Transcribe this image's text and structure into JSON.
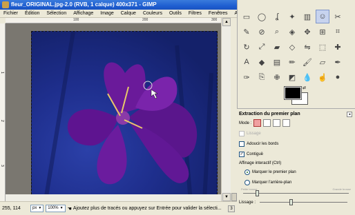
{
  "window": {
    "title": "fleur_ORIGINAL.jpg-2.0 (RVB, 1 calque) 400x371 - GIMP"
  },
  "menu": [
    "Fichier",
    "Édition",
    "Sélection",
    "Affichage",
    "Image",
    "Calque",
    "Couleurs",
    "Outils",
    "Filtres",
    "Fenêtres",
    "Aide"
  ],
  "ruler_top": [
    "100",
    "200",
    "300"
  ],
  "ruler_left": [
    "1",
    "2",
    "3"
  ],
  "status": {
    "coords": "255, 114",
    "unit": "px",
    "zoom": "100%",
    "message": "Ajoutez plus de tracés ou appuyez sur Entrée pour valider la sélecti...",
    "cancel": "3"
  },
  "tools": [
    {
      "name": "rect-select-icon",
      "glyph": "▭"
    },
    {
      "name": "ellipse-select-icon",
      "glyph": "◯"
    },
    {
      "name": "free-select-icon",
      "glyph": "ʆ"
    },
    {
      "name": "fuzzy-select-icon",
      "glyph": "✦"
    },
    {
      "name": "color-select-icon",
      "glyph": "▥"
    },
    {
      "name": "foreground-select-icon",
      "glyph": "☺",
      "active": true
    },
    {
      "name": "scissors-select-icon",
      "glyph": "✂"
    },
    {
      "name": "paths-icon",
      "glyph": "✎"
    },
    {
      "name": "color-picker-icon",
      "glyph": "⊘"
    },
    {
      "name": "zoom-icon",
      "glyph": "⌕"
    },
    {
      "name": "measure-icon",
      "glyph": "◈"
    },
    {
      "name": "move-icon",
      "glyph": "✥"
    },
    {
      "name": "align-icon",
      "glyph": "⊞"
    },
    {
      "name": "crop-icon",
      "glyph": "⌗"
    },
    {
      "name": "rotate-icon",
      "glyph": "↻"
    },
    {
      "name": "scale-icon",
      "glyph": "⤢"
    },
    {
      "name": "shear-icon",
      "glyph": "▰"
    },
    {
      "name": "perspective-icon",
      "glyph": "◇"
    },
    {
      "name": "flip-icon",
      "glyph": "⇋"
    },
    {
      "name": "cage-icon",
      "glyph": "⬚"
    },
    {
      "name": "unified-transform-icon",
      "glyph": "✚"
    },
    {
      "name": "text-icon",
      "glyph": "A"
    },
    {
      "name": "bucket-fill-icon",
      "glyph": "◆"
    },
    {
      "name": "gradient-icon",
      "glyph": "▤"
    },
    {
      "name": "pencil-icon",
      "glyph": "✏"
    },
    {
      "name": "paintbrush-icon",
      "glyph": "🖌"
    },
    {
      "name": "eraser-icon",
      "glyph": "▱"
    },
    {
      "name": "airbrush-icon",
      "glyph": "✒"
    },
    {
      "name": "ink-icon",
      "glyph": "✑"
    },
    {
      "name": "clone-icon",
      "glyph": "⎘"
    },
    {
      "name": "heal-icon",
      "glyph": "✙"
    },
    {
      "name": "perspective-clone-icon",
      "glyph": "◩"
    },
    {
      "name": "blur-icon",
      "glyph": "💧"
    },
    {
      "name": "smudge-icon",
      "glyph": "☝"
    },
    {
      "name": "dodge-burn-icon",
      "glyph": "●"
    }
  ],
  "options": {
    "title": "Extraction du premier plan",
    "mode_label": "Mode :",
    "lissage": "Lissage",
    "adoucir": "Adoucir les bords",
    "contigu": "Contiguë",
    "affinage": "Affinage interactif (Ctrl)",
    "marquer_premier": "Marquer le premier plan",
    "marquer_arriere": "Marquer l'arrière-plan",
    "petite_brosse": "Petite brosse",
    "grande_brosse": "Grande brosse",
    "lissage2": "Lissage :",
    "brush_size": 0.12,
    "smoothing": 0.35
  }
}
